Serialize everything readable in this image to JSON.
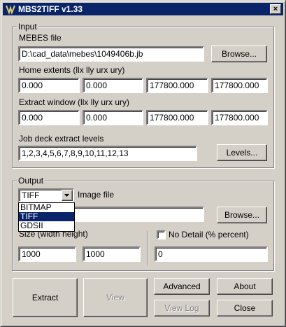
{
  "window": {
    "title": "MBS2TIFF v1.33",
    "close_glyph": "×"
  },
  "input": {
    "legend": "Input",
    "mebes_label": "MEBES file",
    "mebes_value": "D:\\cad_data\\mebes\\1049406b.jb",
    "browse_label": "Browse...",
    "home_label": "Home extents (llx lly urx ury)",
    "home_values": [
      "0.000",
      "0.000",
      "177800.000",
      "177800.000"
    ],
    "extract_label": "Extract window (llx lly urx ury)",
    "extract_values": [
      "0.000",
      "0.000",
      "177800.000",
      "177800.000"
    ],
    "jobdeck_label": "Job deck extract levels",
    "jobdeck_value": "1,2,3,4,5,6,7,8,9,10,11,12,13",
    "levels_label": "Levels..."
  },
  "output": {
    "legend": "Output",
    "format_selected": "TIFF",
    "format_options": [
      "BITMAP",
      "TIFF",
      "GDSII"
    ],
    "image_file_label": "Image file",
    "image_file_value": "",
    "browse_label": "Browse...",
    "size_label": "Size (width height)",
    "width_value": "1000",
    "height_value": "1000",
    "no_detail_label": "No Detail (% percent)",
    "no_detail_checked": false,
    "no_detail_value": "0"
  },
  "actions": {
    "extract": "Extract",
    "view": "View",
    "advanced": "Advanced",
    "about": "About",
    "view_log": "View Log",
    "close": "Close"
  }
}
